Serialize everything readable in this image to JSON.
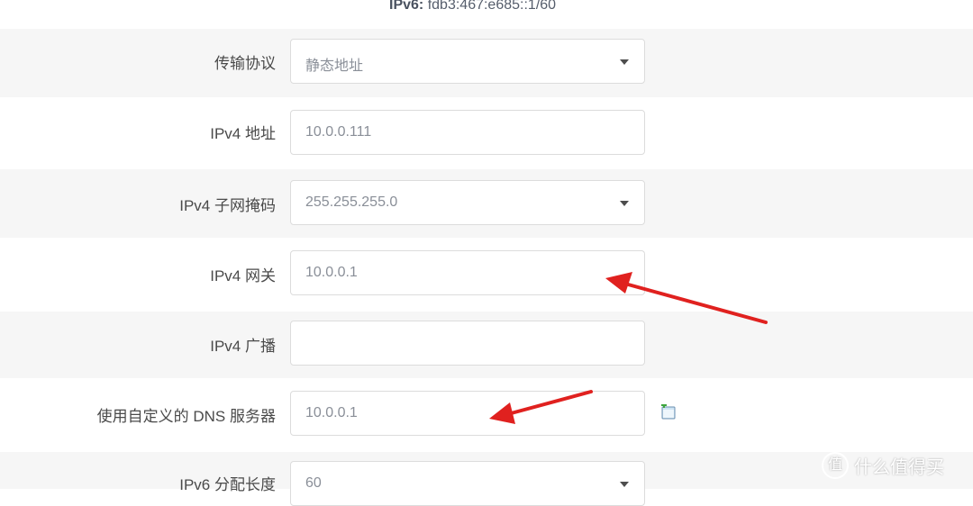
{
  "ipv6_line": {
    "label": "IPv6:",
    "value": "fdb3:467:e685::1/60"
  },
  "form": {
    "rows": [
      {
        "label": "传输协议",
        "value": "静态地址",
        "type": "select"
      },
      {
        "label": "IPv4 地址",
        "value": "10.0.0.111",
        "type": "input"
      },
      {
        "label": "IPv4 子网掩码",
        "value": "255.255.255.0",
        "type": "select"
      },
      {
        "label": "IPv4 网关",
        "value": "10.0.0.1",
        "type": "input"
      },
      {
        "label": "IPv4 广播",
        "value": "",
        "type": "input"
      },
      {
        "label": "使用自定义的 DNS 服务器",
        "value": "10.0.0.1",
        "type": "input"
      },
      {
        "label": "IPv6 分配长度",
        "value": "60",
        "type": "select"
      }
    ]
  },
  "annotations": {
    "arrow_color": "#e0211f"
  },
  "watermark": {
    "logo": "值",
    "text": "什么值得买"
  },
  "icons": {
    "dns_add": "add-entry-icon",
    "select_caret": "chevron-down-icon"
  }
}
